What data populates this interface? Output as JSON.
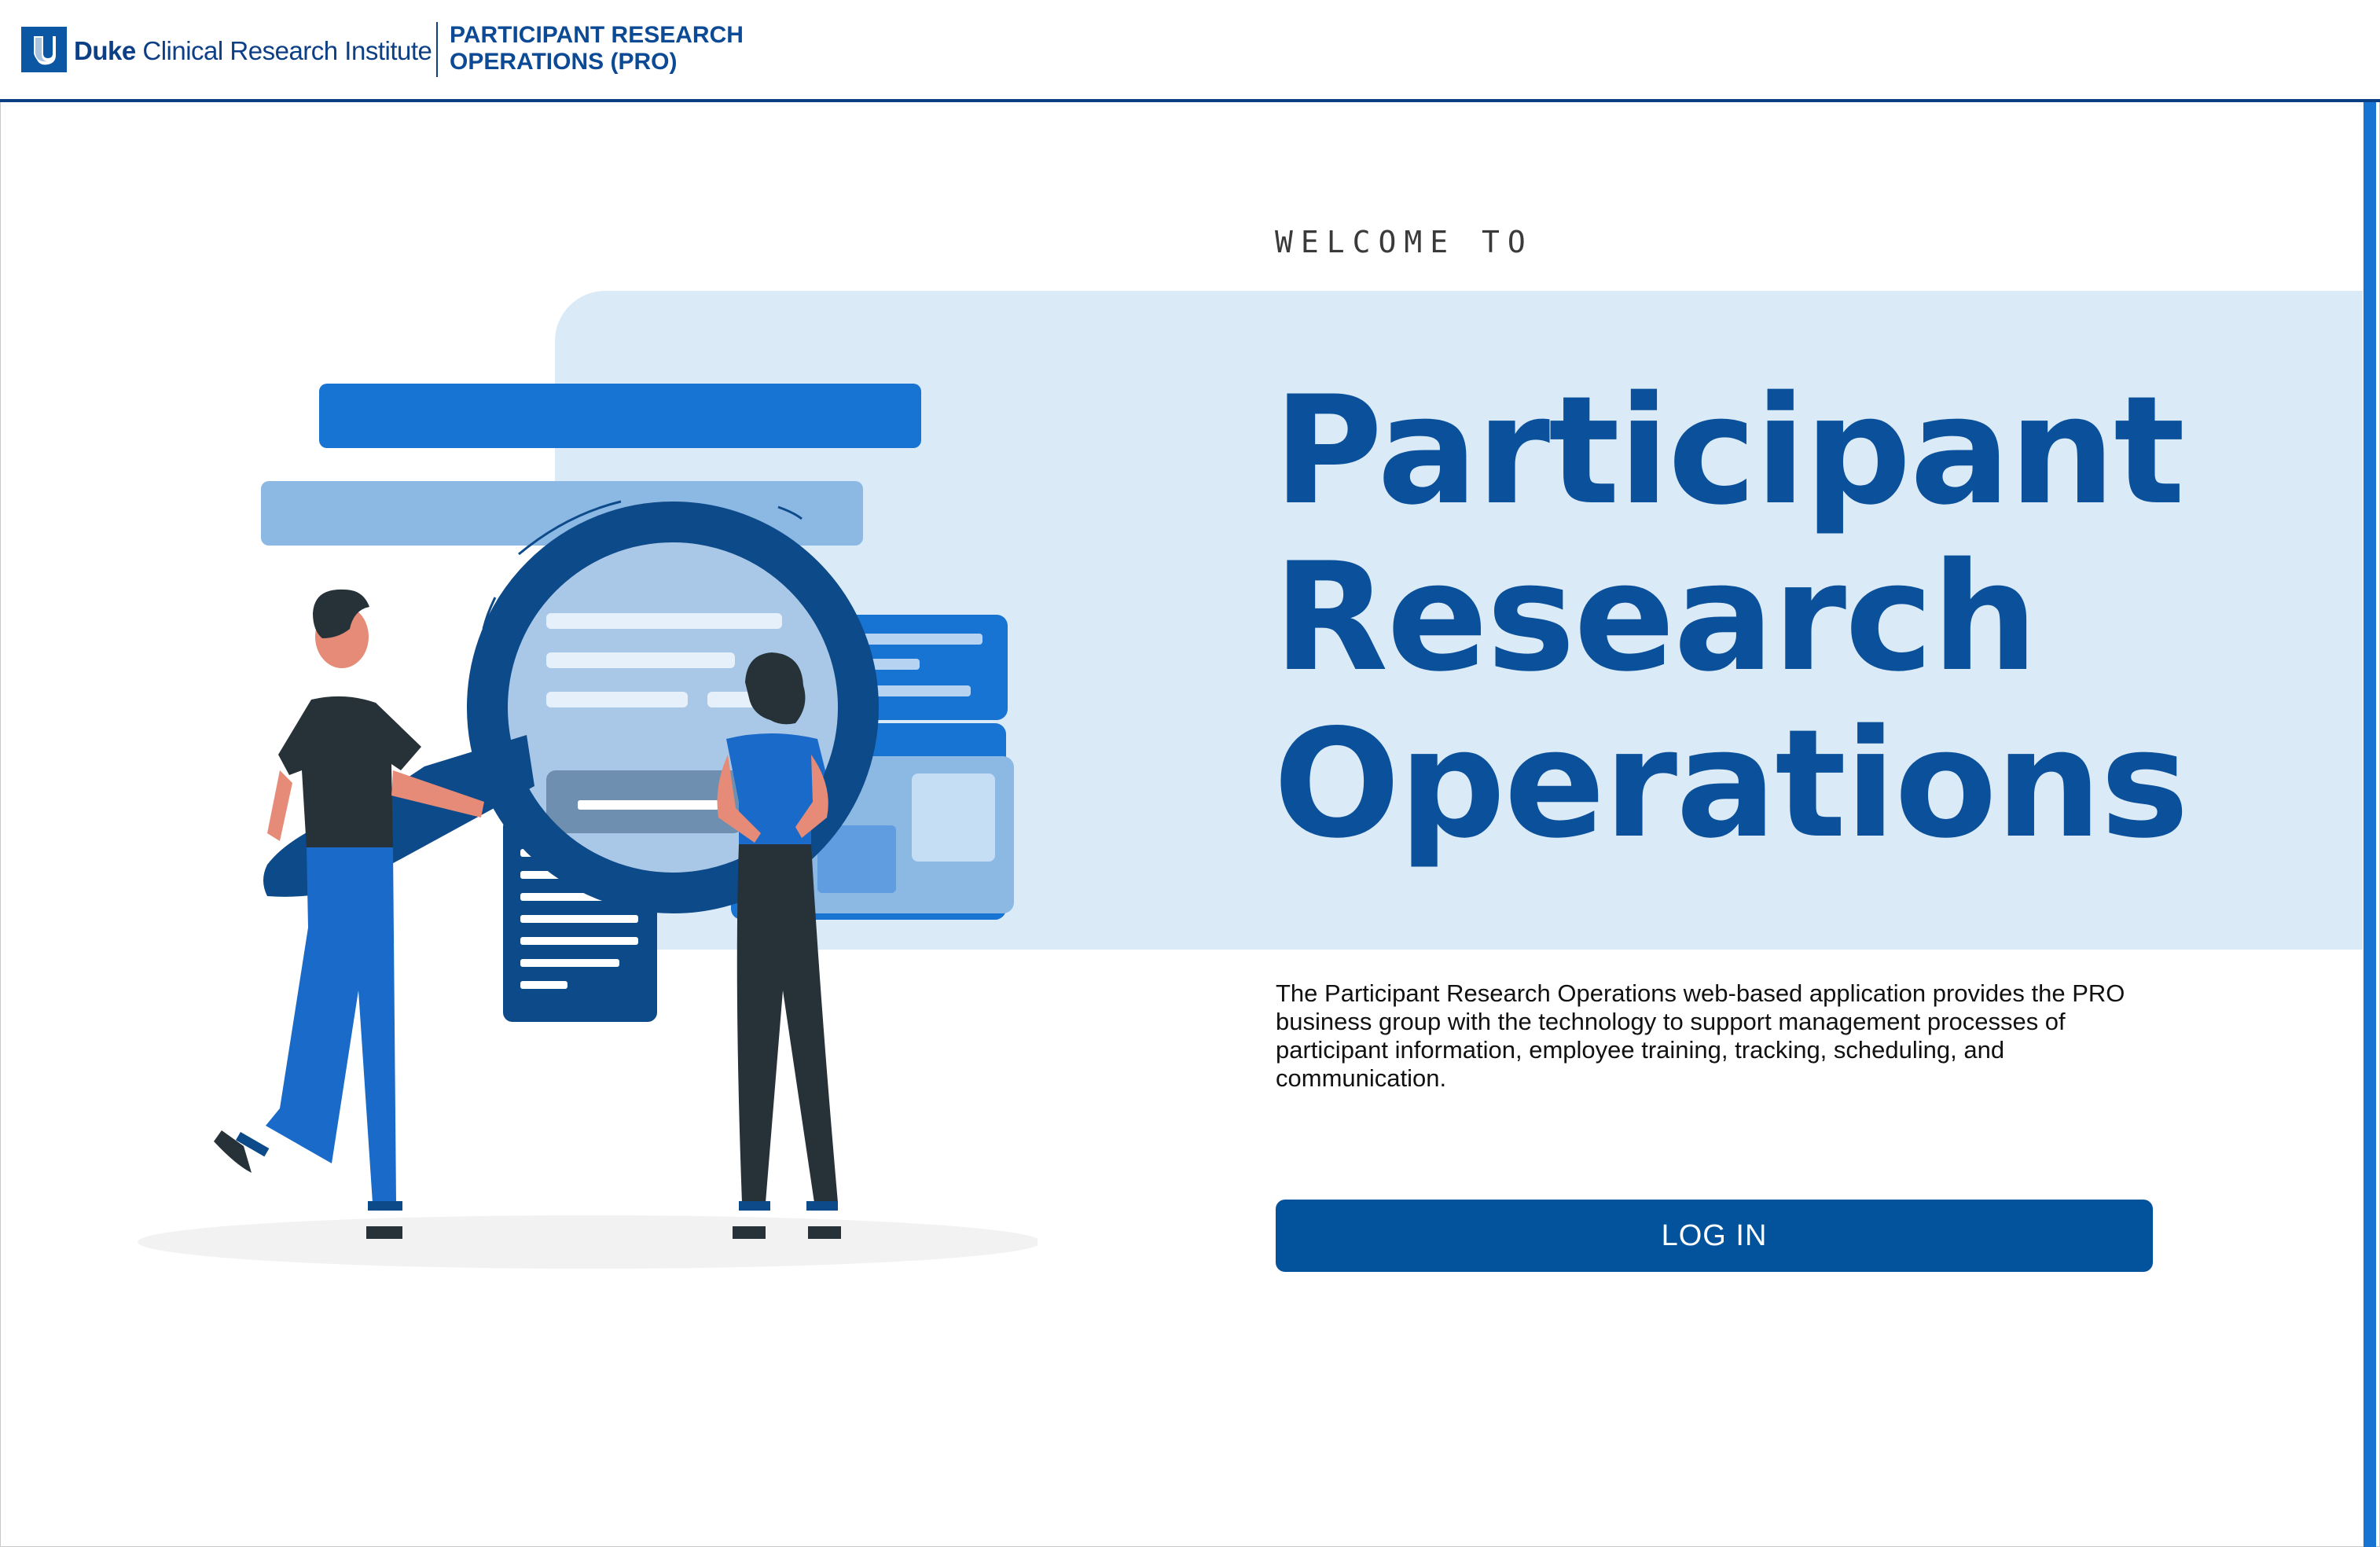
{
  "header": {
    "brand_bold": "Duke",
    "brand_rest": "Clinical Research Institute",
    "app_title_line1": "PARTICIPANT RESEARCH",
    "app_title_line2": "OPERATIONS (PRO)"
  },
  "hero": {
    "welcome": "WELCOME TO",
    "title_line1": "Participant",
    "title_line2": "Research",
    "title_line3": "Operations",
    "description": "The Participant Research Operations web-based application provides the PRO business group with the technology to support management processes of participant information, employee training, tracking, scheduling, and communication.",
    "login_label": "LOG IN"
  },
  "colors": {
    "primary": "#03529c",
    "title": "#0b509a",
    "band": "#daeaf7",
    "accent": "#1874d2"
  },
  "icons": {
    "logo": "duke-shield-icon",
    "illustration": "people-with-magnifying-glass-illustration"
  }
}
